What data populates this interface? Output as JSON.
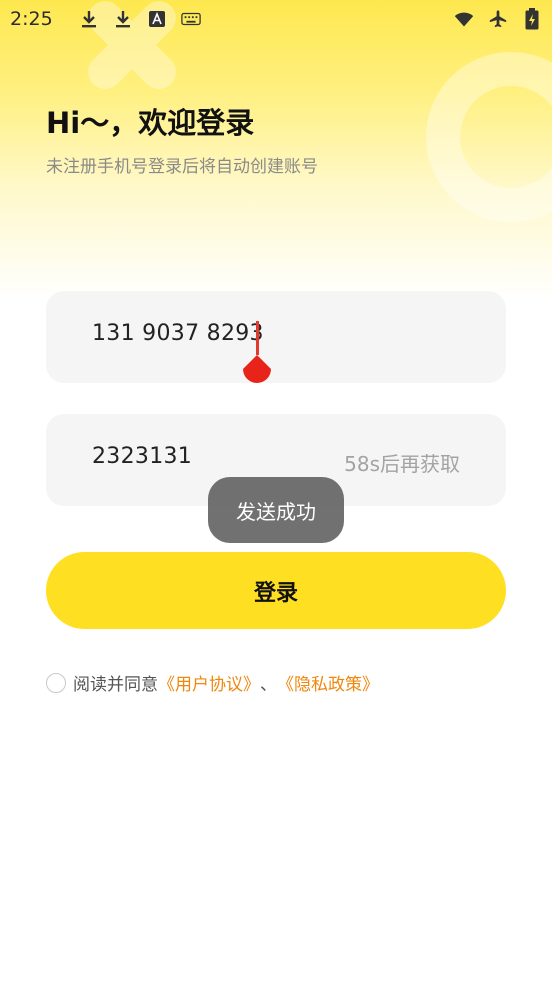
{
  "status_bar": {
    "time": "2:25",
    "left_icons": [
      "download-icon",
      "download-icon",
      "text-a-icon",
      "keyboard-icon"
    ],
    "right_icons": [
      "wifi-icon",
      "airplane-mode-icon",
      "battery-charging-icon"
    ]
  },
  "header": {
    "title": "Hi～，欢迎登录",
    "subtitle": "未注册手机号登录后将自动创建账号"
  },
  "phone_input": {
    "value": "131 9037 8293"
  },
  "code_input": {
    "value": "2323131",
    "resend_label": "58s后再获取"
  },
  "toast": {
    "message": "发送成功"
  },
  "login_button": {
    "label": "登录"
  },
  "agreement": {
    "prefix": "阅读并同意",
    "user_agreement": "《用户协议》",
    "separator": "、",
    "privacy_policy": "《隐私政策》",
    "checked": false
  },
  "colors": {
    "brand_yellow": "#ffdf21",
    "link_orange": "#f0870c",
    "cursor_red": "#e23a2c"
  }
}
